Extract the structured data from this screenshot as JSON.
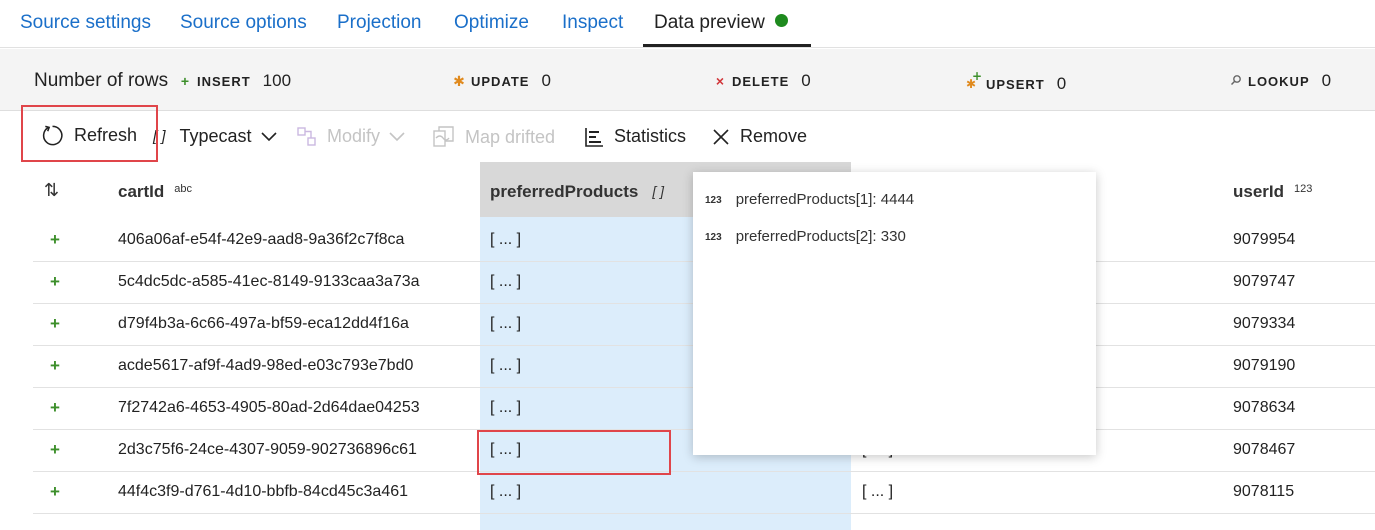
{
  "tabs": [
    {
      "label": "Source settings"
    },
    {
      "label": "Source options"
    },
    {
      "label": "Projection"
    },
    {
      "label": "Optimize"
    },
    {
      "label": "Inspect"
    },
    {
      "label": "Data preview"
    }
  ],
  "status_color": "#1e8a1e",
  "stats": {
    "rows_label": "Number of rows",
    "insert": {
      "label": "INSERT",
      "value": "100",
      "color": "#3d8f2b"
    },
    "update": {
      "label": "UPDATE",
      "value": "0",
      "color": "#e08a1e"
    },
    "delete": {
      "label": "DELETE",
      "value": "0",
      "color": "#d13438"
    },
    "upsert": {
      "label": "UPSERT",
      "value": "0"
    },
    "lookup": {
      "label": "LOOKUP",
      "value": "0"
    }
  },
  "toolbar": {
    "refresh": "Refresh",
    "typecast": "Typecast",
    "modify": "Modify",
    "map_drifted": "Map drifted",
    "statistics": "Statistics",
    "remove": "Remove"
  },
  "table": {
    "columns": [
      {
        "name": "cartId",
        "type": "abc"
      },
      {
        "name": "preferredProducts",
        "type": "[ ]"
      },
      {
        "name": "userId",
        "type": "123"
      }
    ],
    "rows": [
      {
        "cartId": "406a06af-e54f-42e9-aad8-9a36f2c7f8ca",
        "preferredProducts": "[ ... ]",
        "userId": "9079954"
      },
      {
        "cartId": "5c4dc5dc-a585-41ec-8149-9133caa3a73a",
        "preferredProducts": "[ ... ]",
        "userId": "9079747"
      },
      {
        "cartId": "d79f4b3a-6c66-497a-bf59-eca12dd4f16a",
        "preferredProducts": "[ ... ]",
        "userId": "9079334"
      },
      {
        "cartId": "acde5617-af9f-4ad9-98ed-e03c793e7bd0",
        "preferredProducts": "[ ... ]",
        "userId": "9079190"
      },
      {
        "cartId": "7f2742a6-4653-4905-80ad-2d64dae04253",
        "preferredProducts": "[ ... ]",
        "userId": "9078634"
      },
      {
        "cartId": "2d3c75f6-24ce-4307-9059-902736896c61",
        "preferredProducts": "[ ... ]",
        "extra": "[ ... ]",
        "userId": "9078467"
      },
      {
        "cartId": "44f4c3f9-d761-4d10-bbfb-84cd45c3a461",
        "preferredProducts": "[ ... ]",
        "extra": "[ ... ]",
        "userId": "9078115"
      }
    ]
  },
  "popup": {
    "items": [
      {
        "type": "123",
        "text": "preferredProducts[1]: 4444"
      },
      {
        "type": "123",
        "text": "preferredProducts[2]: 330"
      }
    ]
  }
}
